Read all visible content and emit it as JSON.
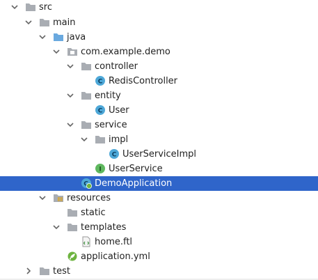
{
  "project_tree": {
    "src": "src",
    "main": "main",
    "java": "java",
    "package": "com.example.demo",
    "controller": "controller",
    "redis_controller": "RedisController",
    "entity": "entity",
    "user": "User",
    "service": "service",
    "impl": "impl",
    "user_service_impl": "UserServiceImpl",
    "user_service": "UserService",
    "demo_application": "DemoApplication",
    "resources": "resources",
    "static": "static",
    "templates": "templates",
    "home_ftl": "home.ftl",
    "application_yml": "application.yml",
    "test": "test"
  },
  "selected_item": "DemoApplication",
  "icons": {
    "folder": "folder-icon",
    "source_folder": "source-folder-icon",
    "resources_folder": "resources-folder-icon",
    "class": "class-icon",
    "interface": "interface-icon",
    "spring_boot_app": "spring-boot-application-icon",
    "ftl_file": "ftl-file-icon",
    "yml_file": "spring-yml-file-icon",
    "expanded": "chevron-down-icon",
    "collapsed": "chevron-right-icon"
  },
  "colors": {
    "selection": "#2f65ca",
    "folder": "#a9adb3",
    "source_folder": "#6aa9df",
    "class_icon": "#4ea8d8",
    "interface_icon": "#5fb85f",
    "spring_green": "#6db33f"
  }
}
